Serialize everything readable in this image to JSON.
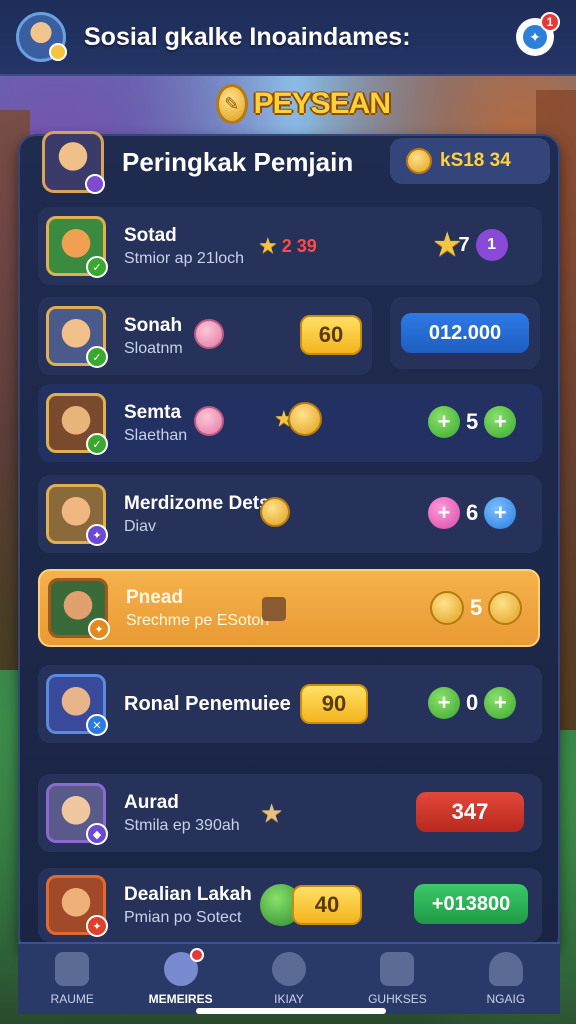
{
  "topbar": {
    "title": "Sosial gkalke Inoaindames:",
    "notification_count": "1"
  },
  "banner": {
    "text": "PEYSEAN"
  },
  "panel": {
    "title": "Peringkak Pemjain",
    "coins": "kS18 34"
  },
  "rows": [
    {
      "name": "Sotad",
      "sub": "Stmior ap 21loch",
      "value": "2 39",
      "right_value": "1",
      "star_count": "7"
    },
    {
      "name": "Sonah",
      "sub": "Sloatnm",
      "pill": "60",
      "side_pill": "012.000"
    },
    {
      "name": "Semta",
      "sub": "Slaethan",
      "count": "5"
    },
    {
      "name": "Merdizome Detsn",
      "sub": "Diav",
      "count": "6"
    },
    {
      "name": "Pnead",
      "sub": "Srechme pe ESoton",
      "count": "5"
    },
    {
      "name": "Ronal Penemuiee",
      "pill": "90",
      "count": "0"
    },
    {
      "name": "Aurad",
      "sub": "Stmila ep 390ah",
      "pill": "347"
    },
    {
      "name": "Dealian Lakah",
      "sub": "Pmian po Sotect",
      "pill": "40",
      "right_pill": "+013800"
    }
  ],
  "nav": [
    {
      "label": "RAUME",
      "icon": "home-icon"
    },
    {
      "label": "MEMEIRES",
      "icon": "members-icon"
    },
    {
      "label": "IKIAY",
      "icon": "gear-icon"
    },
    {
      "label": "GUHKSES",
      "icon": "clipboard-icon"
    },
    {
      "label": "NGAIG",
      "icon": "profile-icon"
    }
  ],
  "colors": {
    "panel_bg": "#1f2b4f",
    "row_bg": "#26325a",
    "highlight": "#f5b24c",
    "accent_gold": "#ffd23a"
  }
}
